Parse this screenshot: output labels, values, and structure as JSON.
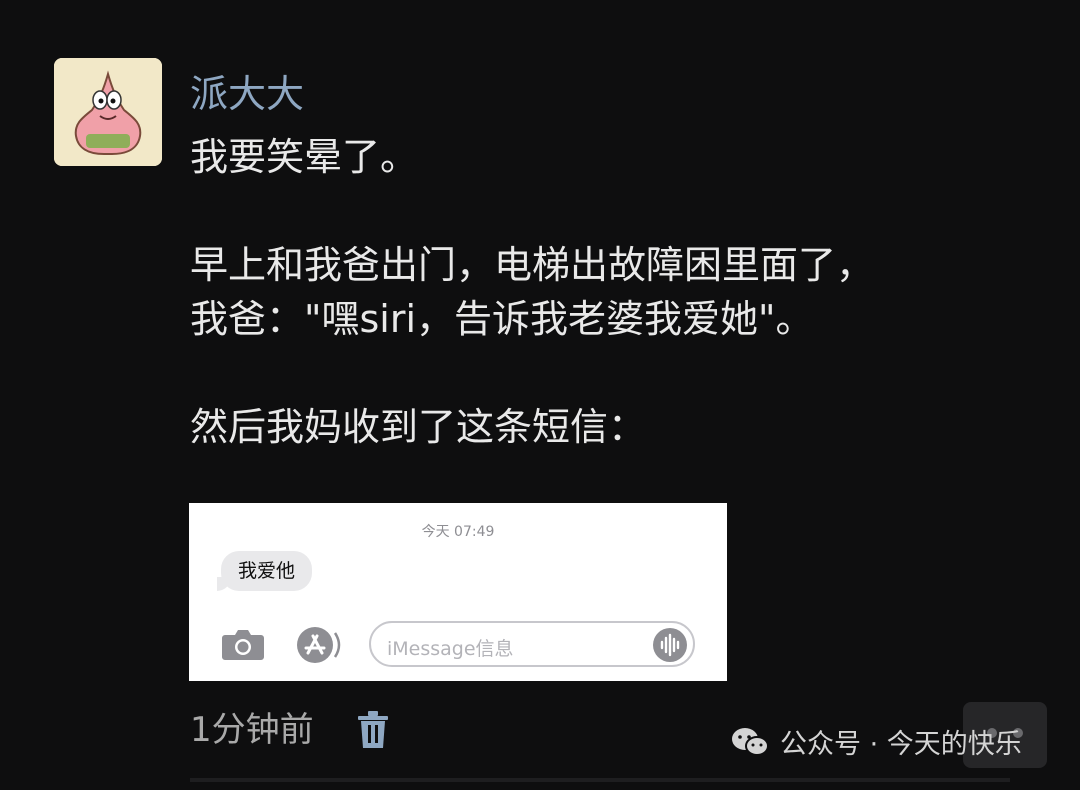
{
  "post": {
    "username": "派大大",
    "lines": [
      "我要笑晕了。",
      "",
      "早上和我爸出门，电梯出故障困里面了，",
      "我爸：\"嘿siri，告诉我老婆我爱她\"。",
      "",
      "然后我妈收到了这条短信："
    ],
    "avatar_icon": "patrick-star-avatar"
  },
  "screenshot": {
    "timestamp": "今天 07:49",
    "message": "我爱他",
    "input_placeholder": "iMessage信息",
    "icons": [
      "camera-icon",
      "app-store-icon",
      "audio-waveform-icon"
    ]
  },
  "footer": {
    "time_ago": "1分钟前",
    "delete_icon": "trash-icon"
  },
  "watermark": {
    "text": "公众号 · 今天的快乐",
    "icon": "wechat-icon"
  },
  "colors": {
    "background": "#0e0e0f",
    "username": "#8ea7c2",
    "text": "#e9e9e9",
    "accent_icon": "#8ea7c2"
  }
}
